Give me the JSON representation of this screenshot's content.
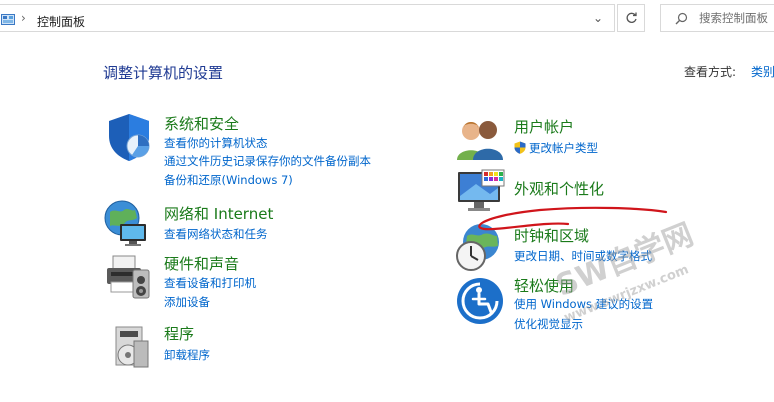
{
  "address_bar": {
    "separator": "›",
    "breadcrumb": "控制面板",
    "dropdown_glyph": "⌄",
    "search_placeholder": "搜索控制面板"
  },
  "header": {
    "title": "调整计算机的设置",
    "view_by_label": "查看方式:",
    "view_by_value": "类别"
  },
  "categories": [
    {
      "id": "system-security",
      "title": "系统和安全",
      "icon": "shield-icon",
      "links": [
        "查看你的计算机状态",
        "通过文件历史记录保存你的文件备份副本",
        "备份和还原(Windows 7)"
      ]
    },
    {
      "id": "network-internet",
      "title": "网络和 Internet",
      "icon": "network-globe-icon",
      "links": [
        "查看网络状态和任务"
      ]
    },
    {
      "id": "hardware-sound",
      "title": "硬件和声音",
      "icon": "printer-speaker-icon",
      "links": [
        "查看设备和打印机",
        "添加设备"
      ]
    },
    {
      "id": "programs",
      "title": "程序",
      "icon": "programs-disc-icon",
      "links": [
        "卸载程序"
      ]
    },
    {
      "id": "user-accounts",
      "title": "用户帐户",
      "icon": "users-icon",
      "links": [
        "更改帐户类型"
      ]
    },
    {
      "id": "appearance",
      "title": "外观和个性化",
      "icon": "monitor-palette-icon",
      "links": []
    },
    {
      "id": "clock-region",
      "title": "时钟和区域",
      "icon": "clock-globe-icon",
      "links": [
        "更改日期、时间或数字格式"
      ]
    },
    {
      "id": "ease-of-access",
      "title": "轻松使用",
      "icon": "ease-of-access-icon",
      "links": [
        "使用 Windows 建议的设置",
        "优化视觉显示"
      ]
    }
  ],
  "watermark": {
    "main": "SW自学网",
    "sub": "www.swrjzxw.com"
  },
  "colors": {
    "title_green": "#1a7a1a",
    "link_blue": "#0066cc",
    "header_blue": "#1f3a93",
    "annotation_red": "#d0151b"
  }
}
